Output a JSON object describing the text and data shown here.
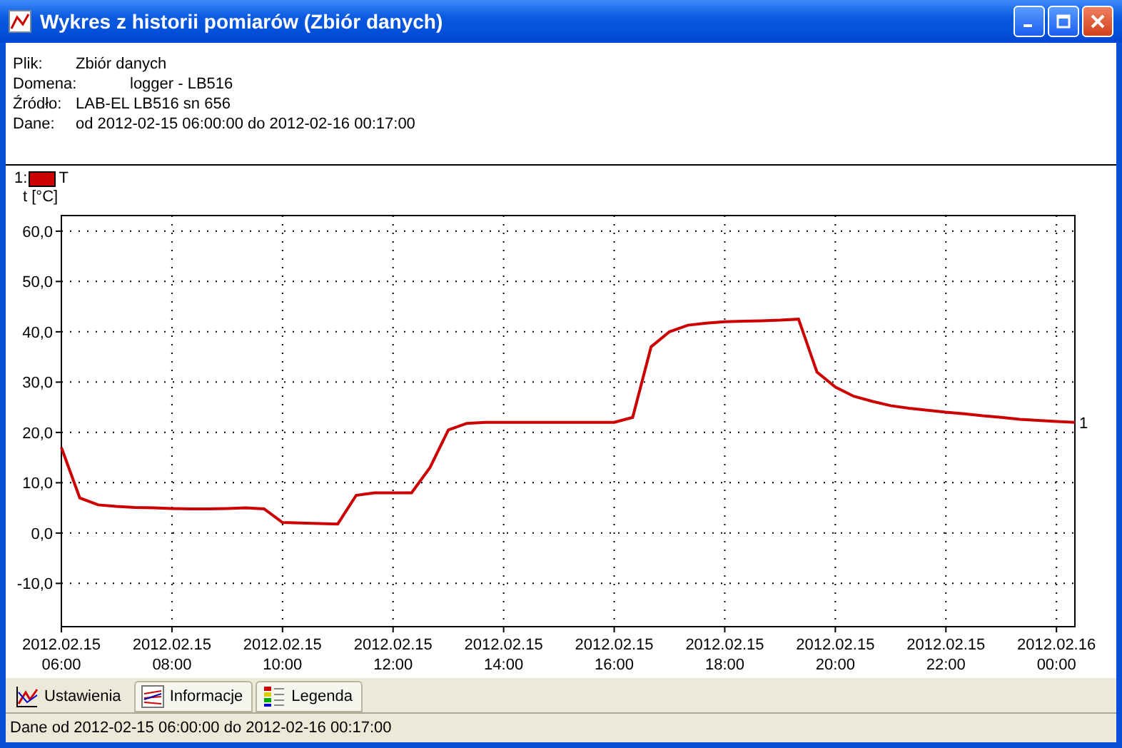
{
  "window": {
    "title": "Wykres z historii pomiarów (Zbiór danych)"
  },
  "info": [
    {
      "label": "Plik:",
      "value": "Zbiór danych"
    },
    {
      "label": "Domena:",
      "value": "logger - LB516"
    },
    {
      "label": "Źródło:",
      "value": "LAB-EL LB516 sn 656"
    },
    {
      "label": "Dane:",
      "value": "od 2012-02-15 06:00:00 do 2012-02-16 00:17:00"
    }
  ],
  "legend": {
    "number": "1:"
  },
  "chart_data": {
    "type": "line",
    "ylabel": "t [°C]",
    "ylim": [
      -18.6,
      63.1
    ],
    "categories": [
      "2012.02.15 06:00",
      null,
      null,
      null,
      null,
      null,
      "2012.02.15 08:00",
      null,
      null,
      null,
      null,
      null,
      "2012.02.15 10:00",
      null,
      null,
      null,
      null,
      null,
      "2012.02.15 12:00",
      null,
      null,
      null,
      null,
      null,
      "2012.02.15 14:00",
      null,
      null,
      null,
      null,
      null,
      "2012.02.15 16:00",
      null,
      null,
      null,
      null,
      null,
      "2012.02.15 18:00",
      null,
      null,
      null,
      null,
      null,
      "2012.02.15 20:00",
      null,
      null,
      null,
      null,
      null,
      "2012.02.15 22:00",
      null,
      null,
      null,
      null,
      null,
      "2012.02.16 00:00",
      null
    ],
    "series": [
      {
        "name": "T",
        "color": "#cc0000",
        "values": [
          17,
          7,
          5.6,
          5.3,
          5.1,
          5,
          4.9,
          4.8,
          4.8,
          4.9,
          5,
          4.8,
          2.1,
          2,
          1.9,
          1.8,
          7.5,
          8,
          8,
          8,
          13,
          20.5,
          21.8,
          22,
          22,
          22,
          22,
          22,
          22,
          22,
          22,
          23,
          37,
          40,
          41.3,
          41.7,
          42,
          42.1,
          42.2,
          42.3,
          42.5,
          32,
          29,
          27.2,
          26.2,
          25.3,
          24.8,
          24.4,
          24,
          23.7,
          23.3,
          23,
          22.6,
          22.4,
          22.2,
          22
        ]
      }
    ],
    "yticks": [
      {
        "value": 60,
        "label": "60,0"
      },
      {
        "value": 50,
        "label": "50,0"
      },
      {
        "value": 40,
        "label": "40,0"
      },
      {
        "value": 30,
        "label": "30,0"
      },
      {
        "value": 20,
        "label": "20,0"
      },
      {
        "value": 10,
        "label": "10,0"
      },
      {
        "value": 0,
        "label": "0,0"
      },
      {
        "value": -10,
        "label": "-10,0"
      }
    ],
    "grid": true,
    "annotations": [
      "1"
    ]
  },
  "tabs": [
    {
      "label": "Ustawienia",
      "selected": true
    },
    {
      "label": "Informacje",
      "selected": false
    },
    {
      "label": "Legenda",
      "selected": false
    }
  ],
  "status_bar": "Dane od 2012-02-15 06:00:00 do 2012-02-16 00:17:00"
}
